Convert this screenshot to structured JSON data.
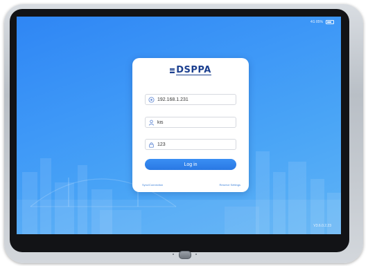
{
  "status_bar": {
    "text": "4G 85%"
  },
  "logo": {
    "text": "DSPPA"
  },
  "form": {
    "server": {
      "value": "192.168.1.231",
      "icon": "server-icon"
    },
    "username": {
      "value": "kis",
      "icon": "user-icon"
    },
    "password": {
      "value": "123",
      "icon": "lock-icon"
    },
    "login_label": "Log in"
  },
  "links": {
    "left": "Sync/Connection",
    "right": "Reserve Settings"
  },
  "version": "V3.6.0.2.23",
  "colors": {
    "accent": "#2f86f4",
    "button": "#2a78e3",
    "logo": "#1b3f8f"
  }
}
